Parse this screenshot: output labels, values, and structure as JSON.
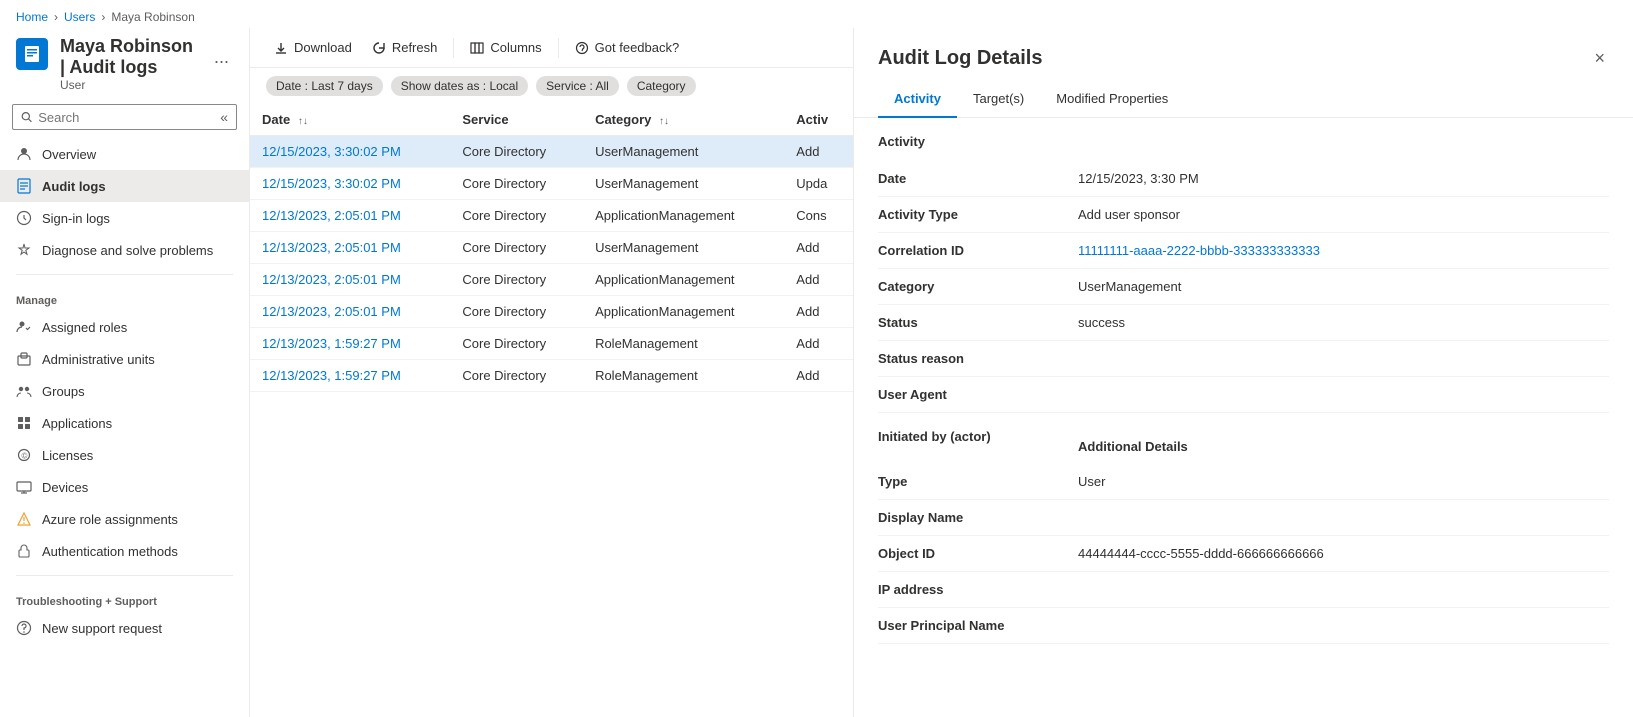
{
  "breadcrumb": {
    "items": [
      "Home",
      "Users",
      "Maya Robinson"
    ]
  },
  "sidebar": {
    "user_icon_label": "User page icon",
    "title": "Maya Robinson | Audit logs",
    "subtitle": "User",
    "more_btn_label": "...",
    "search_placeholder": "Search",
    "collapse_label": "«",
    "nav_items": [
      {
        "id": "overview",
        "label": "Overview",
        "icon": "person"
      },
      {
        "id": "audit-logs",
        "label": "Audit logs",
        "icon": "audit",
        "active": true
      },
      {
        "id": "sign-in-logs",
        "label": "Sign-in logs",
        "icon": "signin"
      },
      {
        "id": "diagnose",
        "label": "Diagnose and solve problems",
        "icon": "diagnose"
      }
    ],
    "manage_label": "Manage",
    "manage_items": [
      {
        "id": "assigned-roles",
        "label": "Assigned roles",
        "icon": "roles"
      },
      {
        "id": "admin-units",
        "label": "Administrative units",
        "icon": "admin"
      },
      {
        "id": "groups",
        "label": "Groups",
        "icon": "groups"
      },
      {
        "id": "applications",
        "label": "Applications",
        "icon": "apps"
      },
      {
        "id": "licenses",
        "label": "Licenses",
        "icon": "licenses"
      },
      {
        "id": "devices",
        "label": "Devices",
        "icon": "devices"
      },
      {
        "id": "azure-roles",
        "label": "Azure role assignments",
        "icon": "azure"
      },
      {
        "id": "auth-methods",
        "label": "Authentication methods",
        "icon": "auth"
      }
    ],
    "troubleshoot_label": "Troubleshooting + Support",
    "support_items": [
      {
        "id": "new-support",
        "label": "New support request",
        "icon": "support"
      }
    ]
  },
  "toolbar": {
    "download_label": "Download",
    "refresh_label": "Refresh",
    "columns_label": "Columns",
    "feedback_label": "Got feedback?"
  },
  "filters": {
    "date_label": "Date : Last 7 days",
    "show_dates_label": "Show dates as : Local",
    "service_label": "Service : All",
    "category_label": "Category"
  },
  "table": {
    "columns": [
      {
        "id": "date",
        "label": "Date",
        "sortable": true
      },
      {
        "id": "service",
        "label": "Service",
        "sortable": false
      },
      {
        "id": "category",
        "label": "Category",
        "sortable": true
      },
      {
        "id": "activity",
        "label": "Activ",
        "sortable": false
      }
    ],
    "rows": [
      {
        "date": "12/15/2023, 3:30:02 PM",
        "service": "Core Directory",
        "category": "UserManagement",
        "activity": "Add",
        "selected": true
      },
      {
        "date": "12/15/2023, 3:30:02 PM",
        "service": "Core Directory",
        "category": "UserManagement",
        "activity": "Upda",
        "selected": false
      },
      {
        "date": "12/13/2023, 2:05:01 PM",
        "service": "Core Directory",
        "category": "ApplicationManagement",
        "activity": "Cons",
        "selected": false
      },
      {
        "date": "12/13/2023, 2:05:01 PM",
        "service": "Core Directory",
        "category": "UserManagement",
        "activity": "Add",
        "selected": false
      },
      {
        "date": "12/13/2023, 2:05:01 PM",
        "service": "Core Directory",
        "category": "ApplicationManagement",
        "activity": "Add",
        "selected": false
      },
      {
        "date": "12/13/2023, 2:05:01 PM",
        "service": "Core Directory",
        "category": "ApplicationManagement",
        "activity": "Add",
        "selected": false
      },
      {
        "date": "12/13/2023, 1:59:27 PM",
        "service": "Core Directory",
        "category": "RoleManagement",
        "activity": "Add",
        "selected": false
      },
      {
        "date": "12/13/2023, 1:59:27 PM",
        "service": "Core Directory",
        "category": "RoleManagement",
        "activity": "Add",
        "selected": false
      }
    ]
  },
  "detail_panel": {
    "title": "Audit Log Details",
    "close_label": "×",
    "tabs": [
      {
        "id": "activity",
        "label": "Activity",
        "active": true
      },
      {
        "id": "targets",
        "label": "Target(s)",
        "active": false
      },
      {
        "id": "modified",
        "label": "Modified Properties",
        "active": false
      }
    ],
    "activity_section": "Activity",
    "fields": [
      {
        "label": "Date",
        "value": "12/15/2023, 3:30 PM",
        "type": "normal"
      },
      {
        "label": "Activity Type",
        "value": "Add user sponsor",
        "type": "normal"
      },
      {
        "label": "Correlation ID",
        "value": "11111111-aaaa-2222-bbbb-333333333333",
        "type": "link"
      },
      {
        "label": "Category",
        "value": "UserManagement",
        "type": "normal"
      },
      {
        "label": "Status",
        "value": "success",
        "type": "normal"
      },
      {
        "label": "Status reason",
        "value": "",
        "type": "normal"
      },
      {
        "label": "User Agent",
        "value": "",
        "type": "normal"
      }
    ],
    "actor_section": "Initiated by (actor)",
    "additional_details_label": "Additional Details",
    "actor_fields": [
      {
        "label": "Type",
        "value": "User",
        "type": "normal"
      },
      {
        "label": "Display Name",
        "value": "",
        "type": "normal"
      },
      {
        "label": "Object ID",
        "value": "44444444-cccc-5555-dddd-666666666666",
        "type": "normal"
      },
      {
        "label": "IP address",
        "value": "",
        "type": "normal"
      },
      {
        "label": "User Principal Name",
        "value": "",
        "type": "normal"
      }
    ]
  }
}
